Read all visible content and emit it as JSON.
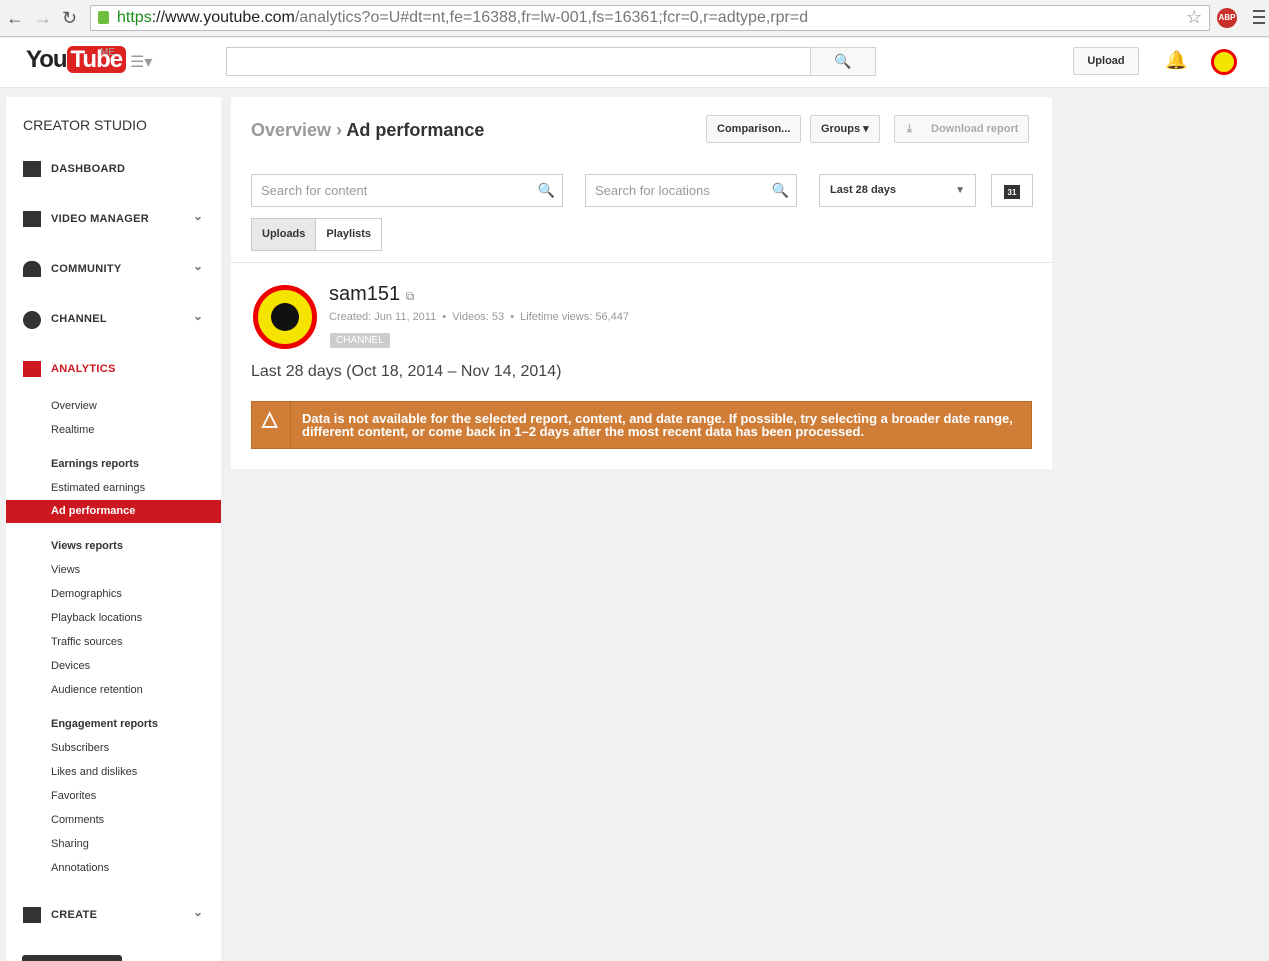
{
  "browser": {
    "url_scheme": "https",
    "url_host": "://www.youtube.com",
    "url_path": "/analytics?o=U#dt=nt,fe=16388,fr=lw-001,fs=16361;fcr=0,r=adtype,rpr=d",
    "abp": "ABP"
  },
  "masthead": {
    "logo_you": "You",
    "logo_tube": "Tube",
    "me": "ME",
    "upload": "Upload"
  },
  "sidebar": {
    "title": "CREATOR STUDIO",
    "dashboard": "DASHBOARD",
    "video_manager": "VIDEO MANAGER",
    "community": "COMMUNITY",
    "channel": "CHANNEL",
    "analytics": "ANALYTICS",
    "create": "CREATE",
    "items": [
      "Overview",
      "Realtime",
      "Earnings reports",
      "Estimated earnings",
      "Ad performance",
      "Views reports",
      "Views",
      "Demographics",
      "Playback locations",
      "Traffic sources",
      "Devices",
      "Audience retention",
      "Engagement reports",
      "Subscribers",
      "Likes and dislikes",
      "Favorites",
      "Comments",
      "Sharing",
      "Annotations"
    ]
  },
  "main": {
    "breadcrumb_root": "Overview",
    "breadcrumb_sep": " › ",
    "breadcrumb_current": "Ad performance",
    "comparison": "Comparison...",
    "groups": "Groups",
    "download": "Download report",
    "search_content_placeholder": "Search for content",
    "search_locations_placeholder": "Search for locations",
    "date_range": "Last 28 days",
    "calendar_day": "31",
    "tabs": [
      "Uploads",
      "Playlists"
    ],
    "channel": {
      "name": "sam151",
      "meta": "Created: Jun 11, 2011  •  Videos: 53  •  Lifetime views: 56,447",
      "badge": "CHANNEL"
    },
    "range_text": "Last 28 days (Oct 18, 2014 – Nov 14, 2014)",
    "alert": "Data is not available for the selected report, content, and date range. If possible, try selecting a broader date range, different content, or come back in 1–2 days after the most recent data has been processed."
  }
}
